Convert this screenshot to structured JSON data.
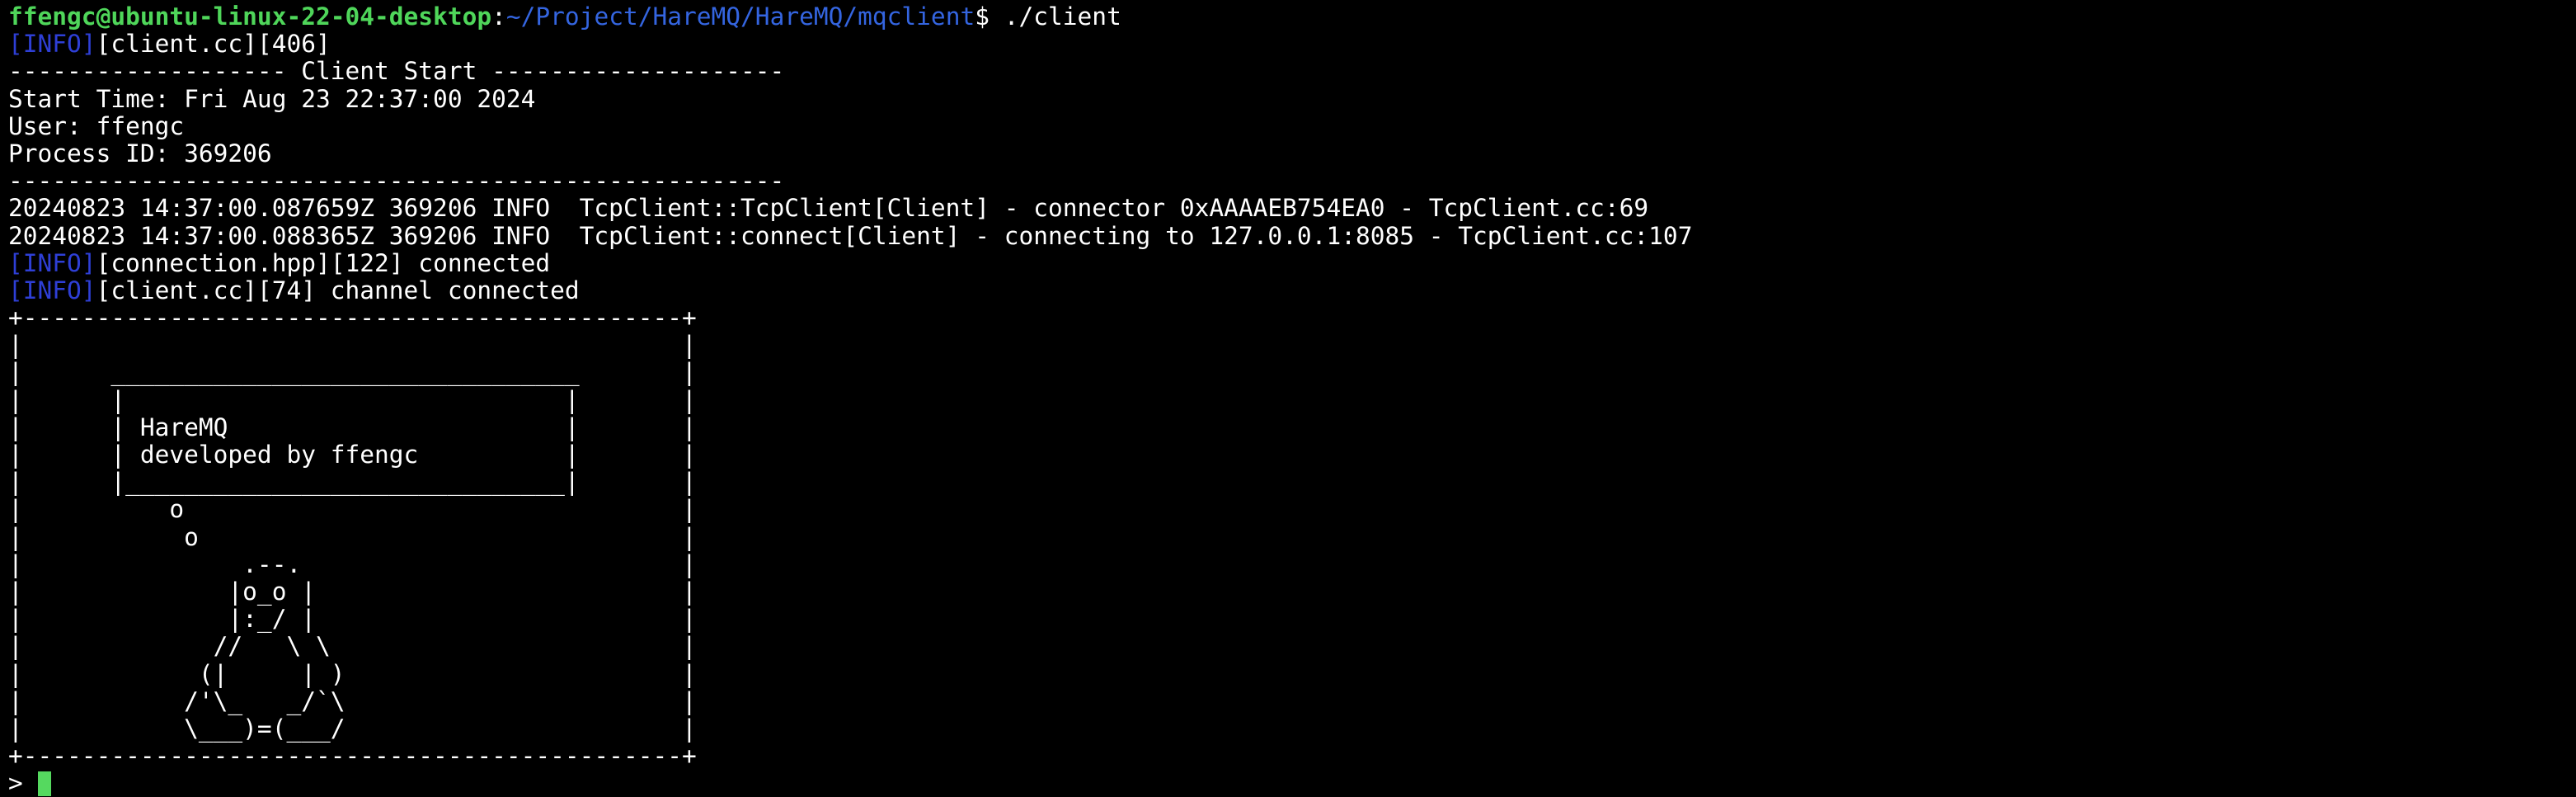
{
  "prompt": {
    "user_host": "ffengc@ubuntu-linux-22-04-desktop",
    "colon": ":",
    "path": "~/Project/HareMQ/HareMQ/mqclient",
    "symbol": "$",
    "command": " ./client"
  },
  "log": {
    "info_tag": "[INFO]",
    "line1_rest": "[client.cc][406]",
    "header": "------------------- Client Start --------------------",
    "start_time": "Start Time: Fri Aug 23 22:37:00 2024",
    "user": "User: ffengc",
    "process_id": "Process ID: 369206",
    "footer": "-----------------------------------------------------",
    "tcp1": "20240823 14:37:00.087659Z 369206 INFO  TcpClient::TcpClient[Client] - connector 0xAAAAEB754EA0 - TcpClient.cc:69",
    "tcp2": "20240823 14:37:00.088365Z 369206 INFO  TcpClient::connect[Client] - connecting to 127.0.0.1:8085 - TcpClient.cc:107",
    "conn_rest": "[connection.hpp][122] connected",
    "chan_rest": "[client.cc][74] channel connected"
  },
  "banner": {
    "lines": [
      "+---------------------------------------------+",
      "|                                             |",
      "|      ________________________________       |",
      "|      |                              |       |",
      "|      | HareMQ                       |       |",
      "|      | developed by ffengc          |       |",
      "|      |______________________________|       |",
      "|          o                                  |",
      "|           o                                 |",
      "|               .--.                          |",
      "|              |o_o |                         |",
      "|              |:_/ |                         |",
      "|             //   \\ \\                        |",
      "|            (|     | )                       |",
      "|           /'\\_   _/`\\                       |",
      "|           \\___)=(___/                       |",
      "+---------------------------------------------+"
    ]
  },
  "input": {
    "prompt_char": "> ",
    "value": ""
  },
  "colors": {
    "background": "#000000",
    "text": "#ffffff",
    "prompt_user": "#4fd65a",
    "prompt_path": "#3465e0",
    "info_tag": "#2e3fd6",
    "cursor": "#55d95f"
  }
}
